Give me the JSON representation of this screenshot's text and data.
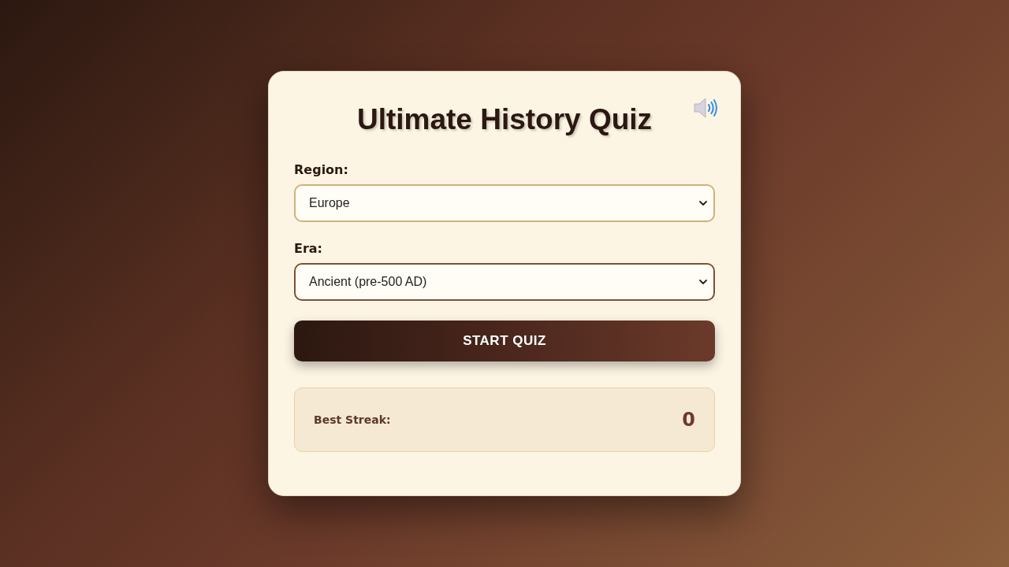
{
  "quiz": {
    "title": "Ultimate History Quiz",
    "sound": {
      "muted": false
    },
    "fields": [
      {
        "label": "Region:",
        "value": "Europe",
        "focused": false
      },
      {
        "label": "Era:",
        "value": "Ancient (pre-500 AD)",
        "focused": true
      }
    ],
    "start_button": "START QUIZ",
    "best_streak": {
      "label": "Best Streak:",
      "value": "0"
    }
  }
}
